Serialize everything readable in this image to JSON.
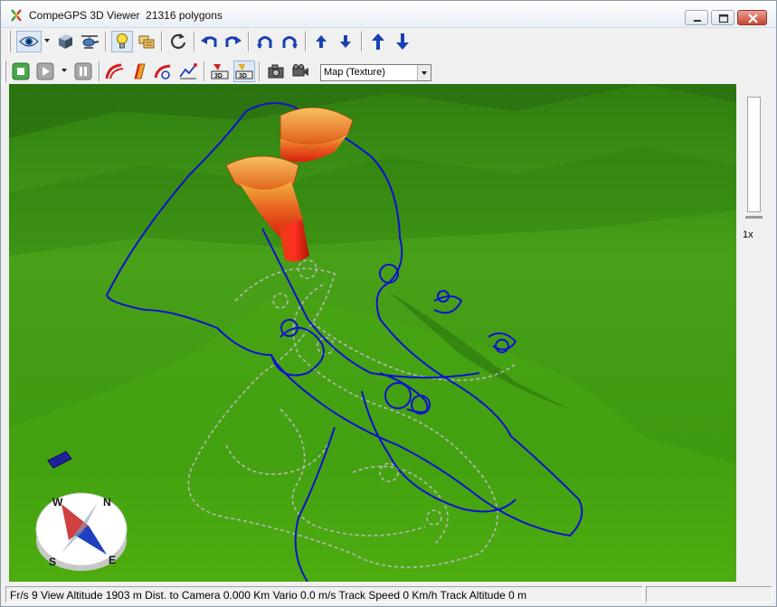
{
  "window": {
    "title": "CompeGPS 3D Viewer  21316 polygons"
  },
  "toolbar_top": {
    "buttons": [
      "eye-view",
      "cube-view",
      "helicopter-view",
      "light",
      "texture",
      "refresh",
      "rotate-left",
      "rotate-right",
      "tilt-up",
      "tilt-down",
      "move-up",
      "move-down",
      "raise",
      "lower"
    ]
  },
  "toolbar_bottom": {
    "map_select_value": "Map (Texture)"
  },
  "zoom": {
    "label": "1x"
  },
  "status": {
    "text": "Fr/s 9 View Altitude 1903 m Dist. to Camera 0.000 Km Vario 0.0 m/s Track Speed 0 Km/h Track Altitude 0 m"
  },
  "compass": {
    "N": "N",
    "S": "S",
    "E": "E",
    "W": "W"
  },
  "colors": {
    "terrain": "#3a8a14",
    "track_main": "#1010d0",
    "track_ghost": "#b8b8b8",
    "thermal_top": "#f0a040",
    "thermal_bottom": "#e02010"
  }
}
